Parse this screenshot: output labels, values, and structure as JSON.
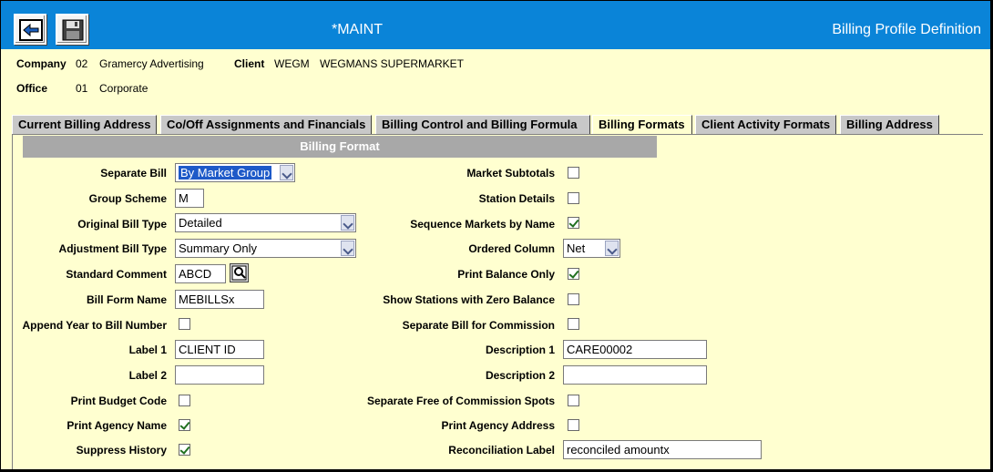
{
  "window": {
    "title": "*MAINT",
    "screen_title": "Billing Profile Definition"
  },
  "header": {
    "company_label": "Company",
    "company_code": "02",
    "company_name": "Gramercy Advertising",
    "client_label": "Client",
    "client_code": "WEGM",
    "client_name": "WEGMANS SUPERMARKET",
    "office_label": "Office",
    "office_code": "01",
    "office_name": "Corporate"
  },
  "tabs": [
    {
      "label": "Current Billing Address",
      "active": false
    },
    {
      "label": "Co/Off Assignments and Financials",
      "active": false
    },
    {
      "label": "Billing Control and Billing Formula",
      "active": false
    },
    {
      "label": "Billing Formats",
      "active": true
    },
    {
      "label": "Client Activity Formats",
      "active": false
    },
    {
      "label": "Billing Address",
      "active": false
    }
  ],
  "section": {
    "title": "Billing Format"
  },
  "left_fields": {
    "separate_bill": {
      "label": "Separate Bill",
      "value": "By Market Group"
    },
    "group_scheme": {
      "label": "Group Scheme",
      "value": "M"
    },
    "original_bill_type": {
      "label": "Original Bill Type",
      "value": "Detailed"
    },
    "adjustment_bill_type": {
      "label": "Adjustment Bill Type",
      "value": "Summary Only"
    },
    "standard_comment": {
      "label": "Standard Comment",
      "value": "ABCD"
    },
    "bill_form_name": {
      "label": "Bill Form Name",
      "value": "MEBILLSx"
    },
    "append_year": {
      "label": "Append Year to Bill Number",
      "checked": false
    },
    "label1": {
      "label": "Label 1",
      "value": "CLIENT ID"
    },
    "label2": {
      "label": "Label 2",
      "value": ""
    },
    "print_budget_code": {
      "label": "Print Budget Code",
      "checked": false
    },
    "print_agency_name": {
      "label": "Print Agency Name",
      "checked": true
    },
    "suppress_history": {
      "label": "Suppress History",
      "checked": true
    }
  },
  "right_fields": {
    "market_subtotals": {
      "label": "Market Subtotals",
      "checked": false
    },
    "station_details": {
      "label": "Station Details",
      "checked": false
    },
    "sequence_markets": {
      "label": "Sequence Markets by Name",
      "checked": true
    },
    "ordered_column": {
      "label": "Ordered Column",
      "value": "Net"
    },
    "print_balance_only": {
      "label": "Print Balance Only",
      "checked": true
    },
    "show_stations_zero": {
      "label": "Show Stations with Zero Balance",
      "checked": false
    },
    "separate_bill_commission": {
      "label": "Separate Bill for Commission",
      "checked": false
    },
    "description1": {
      "label": "Description 1",
      "value": "CARE00002"
    },
    "description2": {
      "label": "Description 2",
      "value": ""
    },
    "separate_free_commission": {
      "label": "Separate Free of Commission Spots",
      "checked": false
    },
    "print_agency_address": {
      "label": "Print Agency Address",
      "checked": false
    },
    "reconciliation_label": {
      "label": "Reconciliation Label",
      "value": "reconciled amountx"
    }
  },
  "icons": {
    "back": "back-arrow-icon",
    "save": "save-disk-icon",
    "lookup": "magnifier-icon"
  },
  "colors": {
    "titlebar": "#0a84d8",
    "background": "#ffffd0",
    "section_bar": "#a8a8a8"
  }
}
